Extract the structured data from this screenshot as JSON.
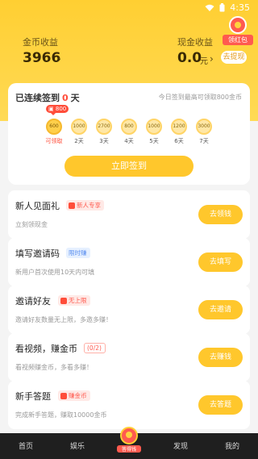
{
  "status": {
    "time": "4:35"
  },
  "header": {
    "coin_label": "金币收益",
    "coin_value": "3966",
    "cash_label": "现金收益",
    "cash_value": "0.0",
    "cash_unit": "元",
    "withdraw_label": "去提现",
    "redpacket_label": "领红包",
    "accent": "#ffd23f"
  },
  "signin": {
    "streak_prefix": "已连续签到",
    "streak_days": "0",
    "streak_suffix": "天",
    "tip": "今日签到最高可领取800金币",
    "bubble": "800",
    "days": [
      {
        "value": "600",
        "label": "可领取"
      },
      {
        "value": "1000",
        "label": "2天"
      },
      {
        "value": "2700",
        "label": "3天"
      },
      {
        "value": "800",
        "label": "4天"
      },
      {
        "value": "1000",
        "label": "5天"
      },
      {
        "value": "1200",
        "label": "6天"
      },
      {
        "value": "3000",
        "label": "7天"
      }
    ],
    "button": "立即签到"
  },
  "tasks": [
    {
      "title": "新人见面礼",
      "tag": "新人专享",
      "subtitle": "立刻领现金",
      "button": "去领钱"
    },
    {
      "title": "填写邀请码",
      "tag": "限时赚",
      "subtitle": "新用户首次使用10天内可填",
      "button": "去填写"
    },
    {
      "title": "邀请好友",
      "tag": "无上限",
      "subtitle": "邀请好友数量无上限，多邀多赚！",
      "button": "去邀请"
    },
    {
      "title": "看视频，赚金币",
      "tag": "(0/2)",
      "subtitle": "看视频赚金币，多看多赚！",
      "button": "去赚钱"
    },
    {
      "title": "新手答题",
      "tag": "赚金币",
      "subtitle": "完成新手答题，赚取10000金币",
      "button": "去答题"
    }
  ],
  "nav": {
    "home": "首页",
    "entertainment": "娱乐",
    "center": "答得钱",
    "discover": "发现",
    "mine": "我的"
  }
}
